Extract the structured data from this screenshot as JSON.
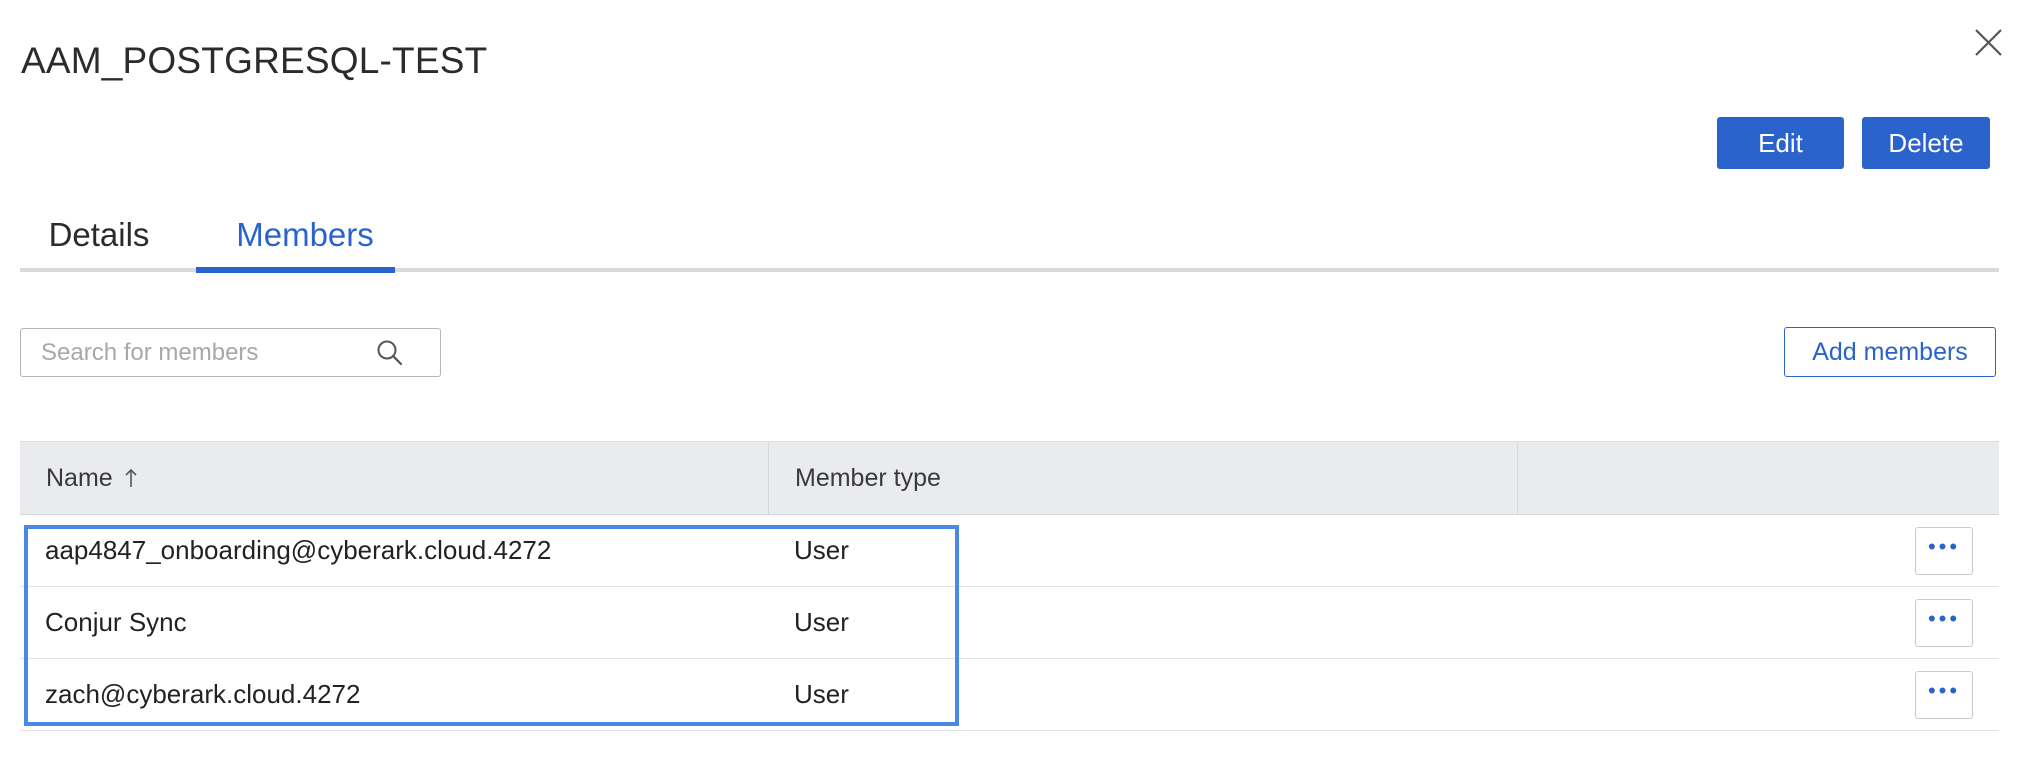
{
  "dialog": {
    "title": "AAM_POSTGRESQL-TEST",
    "close_icon": "close-icon"
  },
  "actions": {
    "edit_label": "Edit",
    "delete_label": "Delete"
  },
  "tabs": [
    {
      "label": "Details",
      "active": false
    },
    {
      "label": "Members",
      "active": true
    }
  ],
  "search": {
    "placeholder": "Search for members",
    "value": "",
    "icon": "search-icon"
  },
  "add_members_label": "Add members",
  "table": {
    "columns": [
      {
        "label": "Name",
        "sort": "ascending",
        "sort_icon": "arrow-up-icon"
      },
      {
        "label": "Member type"
      },
      {
        "label": ""
      }
    ],
    "rows": [
      {
        "name": "aap4847_onboarding@cyberark.cloud.4272",
        "member_type": "User",
        "more_label": "•••"
      },
      {
        "name": "Conjur Sync",
        "member_type": "User",
        "more_label": "•••"
      },
      {
        "name": "zach@cyberark.cloud.4272",
        "member_type": "User",
        "more_label": "•••"
      }
    ]
  },
  "colors": {
    "accent": "#2a63cb",
    "highlight": "#4a88e6",
    "header_bg": "#eaebef"
  }
}
